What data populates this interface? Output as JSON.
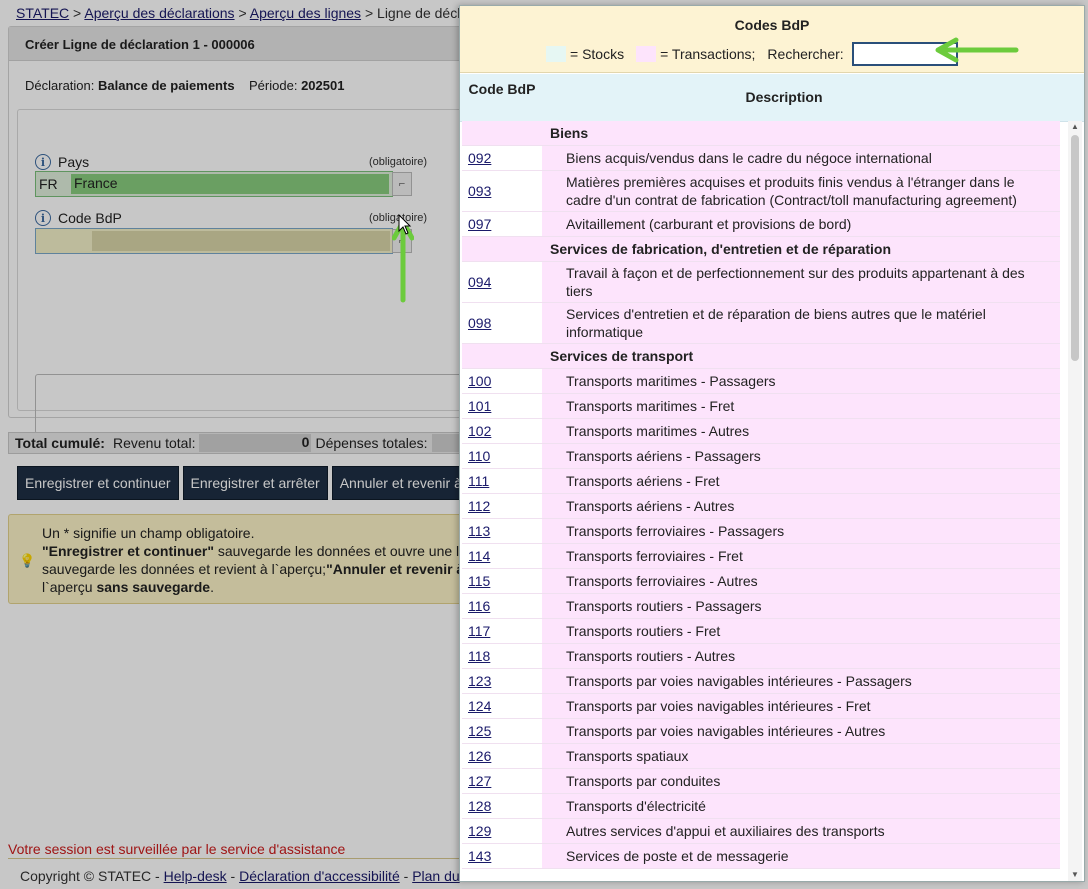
{
  "breadcrumb": {
    "items": [
      {
        "label": "STATEC",
        "link": true
      },
      {
        "label": "Aperçu des déclarations",
        "link": true
      },
      {
        "label": "Aperçu des lignes",
        "link": true
      },
      {
        "label": "Ligne de décl",
        "link": false
      }
    ],
    "sep": ">"
  },
  "card": {
    "title": "Créer Ligne de déclaration 1 - 000006",
    "decl_label": "Déclaration:",
    "decl_value": "Balance de paiements",
    "period_label": "Période:",
    "period_value": "202501"
  },
  "fields": {
    "pays": {
      "label": "Pays",
      "required": "(obligatoire)",
      "code": "FR",
      "value": "France"
    },
    "code_bdp": {
      "label": "Code BdP",
      "required": "(obligatoire)",
      "value": ""
    }
  },
  "totals": {
    "label": "Total cumulé:",
    "revenue_label": "Revenu total:",
    "revenue_value": "0",
    "expense_label": "Dépenses totales:"
  },
  "buttons": {
    "save_continue": "Enregistrer et continuer",
    "save_stop": "Enregistrer et arrêter",
    "cancel_back": "Annuler et revenir à l"
  },
  "note": {
    "line1": "Un * signifie un champ obligatoire.",
    "line2_bold": "\"Enregistrer et continuer\"",
    "line2_rest": " sauvegarde les données et ouvre une l",
    "line3_a": "sauvegarde les données et revient à l`aperçu;",
    "line3_bold": "\"Annuler et revenir à",
    "line4_a": "l`aperçu ",
    "line4_bold": "sans sauvegarde",
    "line4_b": "."
  },
  "session_notice": "Votre session est surveillée par le service d'assistance",
  "footer": {
    "copyright": "Copyright © STATEC -",
    "helpdesk": "Help-desk",
    "sep": "-",
    "accessibility": "Déclaration d'accessibilité",
    "sitemap": "Plan du"
  },
  "dialog": {
    "title": "Codes BdP",
    "legend_stocks": "= Stocks",
    "legend_transactions": "= Transactions;",
    "search_label": "Rechercher:",
    "search_value": "",
    "col_code": "Code BdP",
    "col_desc": "Description",
    "colors": {
      "stocks": "#e6f7f3",
      "transactions": "#fde4fc"
    },
    "rows": [
      {
        "code": "",
        "desc": "Biens",
        "cat": true
      },
      {
        "code": "092",
        "desc": "Biens acquis/vendus dans le cadre du négoce international"
      },
      {
        "code": "093",
        "desc": "Matières premières acquises et produits finis vendus à l'étranger dans le cadre d'un contrat de fabrication (Contract/toll manufacturing agreement)"
      },
      {
        "code": "097",
        "desc": "Avitaillement (carburant et provisions de bord)"
      },
      {
        "code": "",
        "desc": "Services de fabrication, d'entretien et de réparation",
        "cat": true
      },
      {
        "code": "094",
        "desc": "Travail à façon et de perfectionnement sur des produits appartenant à des tiers"
      },
      {
        "code": "098",
        "desc": "Services d'entretien et de réparation de biens autres que le matériel informatique"
      },
      {
        "code": "",
        "desc": "Services de transport",
        "cat": true
      },
      {
        "code": "100",
        "desc": "Transports maritimes - Passagers"
      },
      {
        "code": "101",
        "desc": "Transports maritimes - Fret"
      },
      {
        "code": "102",
        "desc": "Transports maritimes - Autres"
      },
      {
        "code": "110",
        "desc": "Transports aériens - Passagers"
      },
      {
        "code": "111",
        "desc": "Transports aériens - Fret"
      },
      {
        "code": "112",
        "desc": "Transports aériens - Autres"
      },
      {
        "code": "113",
        "desc": "Transports ferroviaires - Passagers"
      },
      {
        "code": "114",
        "desc": "Transports ferroviaires - Fret"
      },
      {
        "code": "115",
        "desc": "Transports ferroviaires - Autres"
      },
      {
        "code": "116",
        "desc": "Transports routiers - Passagers"
      },
      {
        "code": "117",
        "desc": "Transports routiers - Fret"
      },
      {
        "code": "118",
        "desc": "Transports routiers - Autres"
      },
      {
        "code": "123",
        "desc": "Transports par voies navigables intérieures - Passagers"
      },
      {
        "code": "124",
        "desc": "Transports par voies navigables intérieures - Fret"
      },
      {
        "code": "125",
        "desc": "Transports par voies navigables intérieures - Autres"
      },
      {
        "code": "126",
        "desc": "Transports spatiaux"
      },
      {
        "code": "127",
        "desc": "Transports par conduites"
      },
      {
        "code": "128",
        "desc": "Transports d'électricité"
      },
      {
        "code": "129",
        "desc": "Autres services d'appui et auxiliaires des transports"
      },
      {
        "code": "143",
        "desc": "Services de poste et de messagerie"
      }
    ]
  }
}
